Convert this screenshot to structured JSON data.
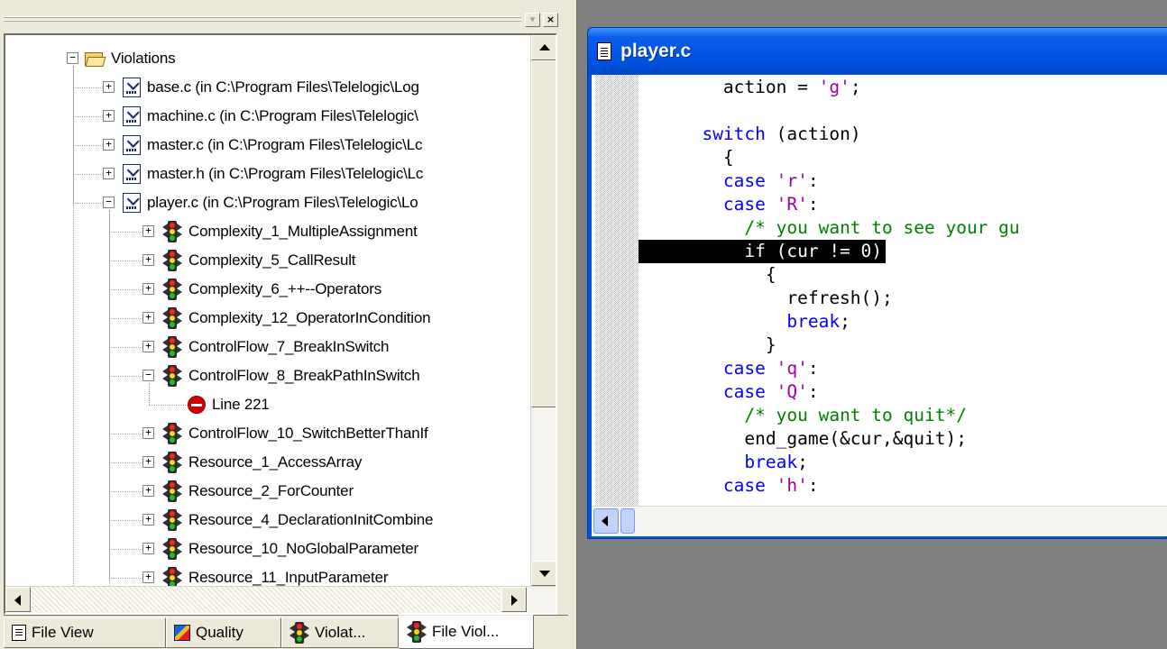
{
  "left_panel": {
    "tree": {
      "root": {
        "label": "Violations",
        "icon": "folder-icon",
        "expanded": true
      },
      "files": [
        {
          "label": "base.c (in C:\\Program Files\\Telelogic\\Log",
          "expanded": false
        },
        {
          "label": "machine.c (in C:\\Program Files\\Telelogic\\",
          "expanded": false
        },
        {
          "label": "master.c (in C:\\Program Files\\Telelogic\\Lc",
          "expanded": false
        },
        {
          "label": "master.h (in C:\\Program Files\\Telelogic\\Lc",
          "expanded": false
        },
        {
          "label": "player.c (in C:\\Program Files\\Telelogic\\Lo",
          "expanded": true
        }
      ],
      "rules": [
        {
          "label": "Complexity_1_MultipleAssignment",
          "expanded": false
        },
        {
          "label": "Complexity_5_CallResult",
          "expanded": false
        },
        {
          "label": "Complexity_6_++--Operators",
          "expanded": false
        },
        {
          "label": "Complexity_12_OperatorInCondition",
          "expanded": false
        },
        {
          "label": "ControlFlow_7_BreakInSwitch",
          "expanded": false
        },
        {
          "label": "ControlFlow_8_BreakPathInSwitch",
          "expanded": true,
          "children": [
            {
              "label": "Line 221",
              "icon": "stop-icon"
            }
          ]
        },
        {
          "label": "ControlFlow_10_SwitchBetterThanIf",
          "expanded": false
        },
        {
          "label": "Resource_1_AccessArray",
          "expanded": false
        },
        {
          "label": "Resource_2_ForCounter",
          "expanded": false
        },
        {
          "label": "Resource_4_DeclarationInitCombine",
          "expanded": false
        },
        {
          "label": "Resource_10_NoGlobalParameter",
          "expanded": false
        },
        {
          "label": "Resource_11_InputParameter",
          "expanded": false
        }
      ]
    },
    "tabs": [
      {
        "label": "File View",
        "icon": "document-icon",
        "active": false
      },
      {
        "label": "Quality",
        "icon": "quality-icon",
        "active": false
      },
      {
        "label": "Violat...",
        "icon": "traffic-light-icon",
        "active": false
      },
      {
        "label": "File Viol...",
        "icon": "traffic-light-icon",
        "active": true
      }
    ]
  },
  "editor": {
    "title": "player.c",
    "lines": [
      [
        {
          "t": "        action = "
        },
        {
          "t": "'g'",
          "c": "str"
        },
        {
          "t": ";"
        }
      ],
      [
        {
          "t": ""
        }
      ],
      [
        {
          "t": "      "
        },
        {
          "t": "switch",
          "c": "kw"
        },
        {
          "t": " (action)"
        }
      ],
      [
        {
          "t": "        {"
        }
      ],
      [
        {
          "t": "        "
        },
        {
          "t": "case",
          "c": "kw"
        },
        {
          "t": " "
        },
        {
          "t": "'r'",
          "c": "str"
        },
        {
          "t": ":"
        }
      ],
      [
        {
          "t": "        "
        },
        {
          "t": "case",
          "c": "kw"
        },
        {
          "t": " "
        },
        {
          "t": "'R'",
          "c": "str"
        },
        {
          "t": ":"
        }
      ],
      [
        {
          "t": "          "
        },
        {
          "t": "/* you want to see your gu",
          "c": "cm"
        }
      ],
      [
        {
          "t": "          if (cur != 0)"
        }
      ],
      [
        {
          "t": "            {"
        }
      ],
      [
        {
          "t": "              refresh();"
        }
      ],
      [
        {
          "t": "              "
        },
        {
          "t": "break",
          "c": "kw"
        },
        {
          "t": ";"
        }
      ],
      [
        {
          "t": "            }"
        }
      ],
      [
        {
          "t": "        "
        },
        {
          "t": "case",
          "c": "kw"
        },
        {
          "t": " "
        },
        {
          "t": "'q'",
          "c": "str"
        },
        {
          "t": ":"
        }
      ],
      [
        {
          "t": "        "
        },
        {
          "t": "case",
          "c": "kw"
        },
        {
          "t": " "
        },
        {
          "t": "'Q'",
          "c": "str"
        },
        {
          "t": ":"
        }
      ],
      [
        {
          "t": "          "
        },
        {
          "t": "/* you want to quit*/",
          "c": "cm"
        }
      ],
      [
        {
          "t": "          end_game(&cur,&quit);"
        }
      ],
      [
        {
          "t": "          "
        },
        {
          "t": "break",
          "c": "kw"
        },
        {
          "t": ";"
        }
      ],
      [
        {
          "t": "        "
        },
        {
          "t": "case",
          "c": "kw"
        },
        {
          "t": " "
        },
        {
          "t": "'h'",
          "c": "str"
        },
        {
          "t": ":"
        }
      ]
    ],
    "highlighted_line": 7
  },
  "colors": {
    "keyword": "#0000ff",
    "string": "#a000a0",
    "comment": "#008000",
    "title_bar": "#0054e3",
    "panel": "#ece9d8"
  }
}
